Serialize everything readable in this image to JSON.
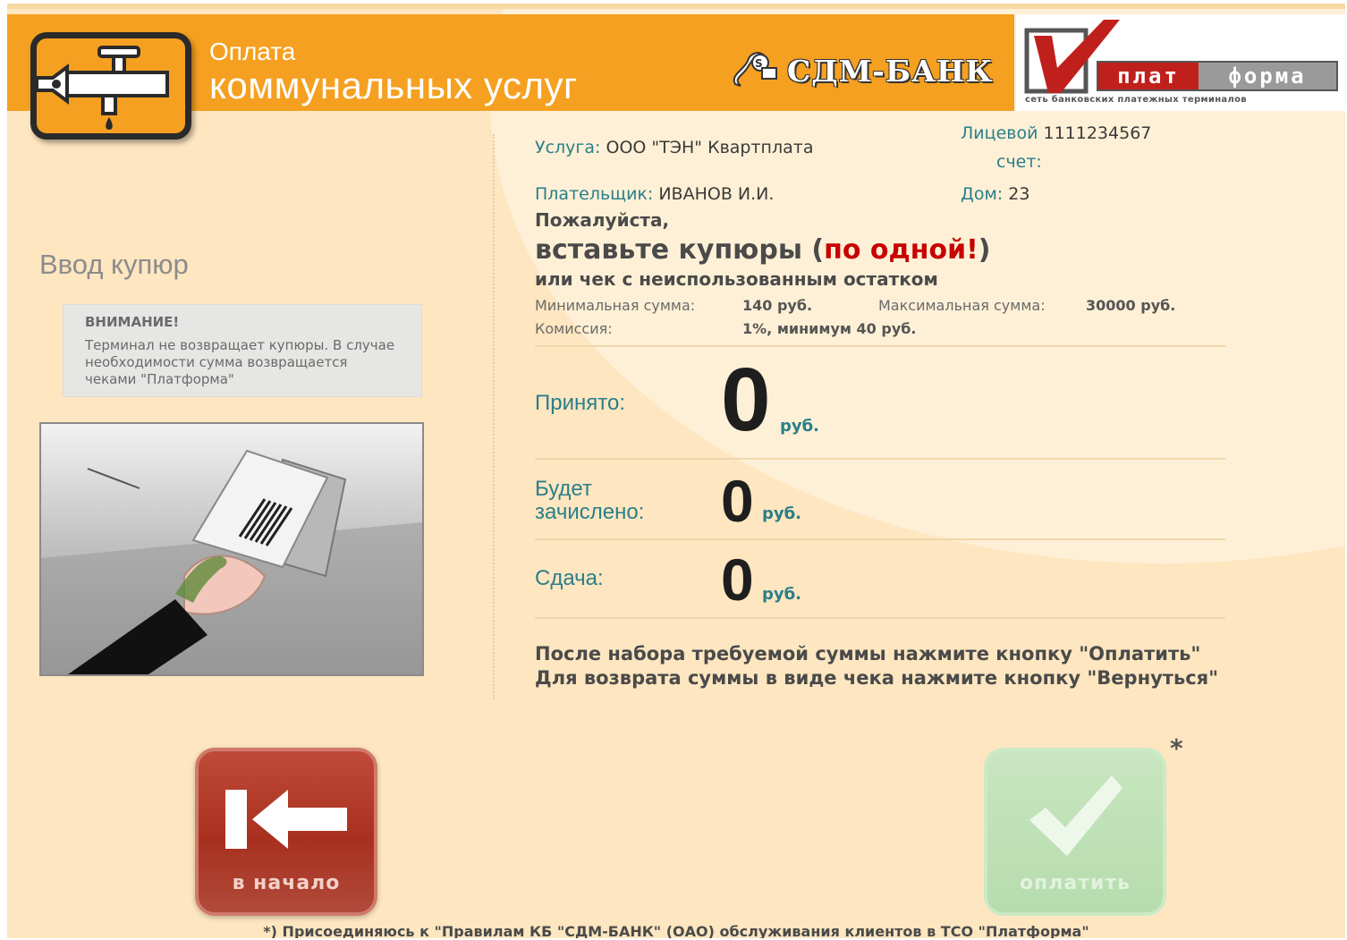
{
  "header": {
    "title_small": "Оплата",
    "title_big": "коммунальных услуг",
    "bank_name": "СДМ-БАНК",
    "platforma_part1": "плат",
    "platforma_part2": "форма",
    "platforma_tagline": "сеть банковских платежных терминалов",
    "icon": "water-tap-icon"
  },
  "left": {
    "title": "Ввод купюр",
    "warning_title": "ВНИМАНИЕ!",
    "warning_text": "Терминал не возвращает купюры. В случае необходимости сумма возвращается чеками \"Платформа\""
  },
  "details": {
    "service_label": "Услуга:",
    "service_value": "ООО \"ТЭН\" Квартплата",
    "payer_label": "Плательщик:",
    "payer_value": "ИВАНОВ И.И.",
    "account_label_1": "Лицевой",
    "account_label_2": "счет:",
    "account_value": "1111234567",
    "house_label": "Дом:",
    "house_value": "23"
  },
  "prompt": {
    "please": "Пожалуйста,",
    "insert": "вставьте купюры (",
    "one_at_a_time": "по одной!",
    "close_paren": ")",
    "or_check": "или чек с неиспользованным остатком"
  },
  "limits": {
    "min_label": "Минимальная сумма:",
    "min_value": "140 руб.",
    "max_label": "Максимальная сумма:",
    "max_value": "30000 руб.",
    "commission_label": "Комиссия:",
    "commission_value": "1%, минимум 40 руб."
  },
  "amounts": {
    "accepted_label": "Принято:",
    "accepted_value": "0",
    "credited_label": "Будет зачислено:",
    "credited_value": "0",
    "change_label": "Сдача:",
    "change_value": "0",
    "currency": "руб."
  },
  "instructions": {
    "line1": "После набора требуемой суммы нажмите кнопку \"Оплатить\"",
    "line2": "Для возврата суммы в виде чека нажмите кнопку \"Вернуться\""
  },
  "buttons": {
    "home_label": "в начало",
    "home_icon": "arrow-left-to-bar-icon",
    "pay_label": "оплатить",
    "pay_icon": "checkmark-icon",
    "asterisk": "*"
  },
  "footer": "*) Присоединяюсь к \"Правилам КБ \"СДМ-БАНК\" (ОАО) обслуживания клиентов в ТСО \"Платформа\"",
  "colors": {
    "accent_orange": "#f5a020",
    "label_teal": "#2a7f8a",
    "alert_red": "#c80000",
    "home_button": "#a8301f",
    "pay_button_disabled": "#b6dcae"
  }
}
